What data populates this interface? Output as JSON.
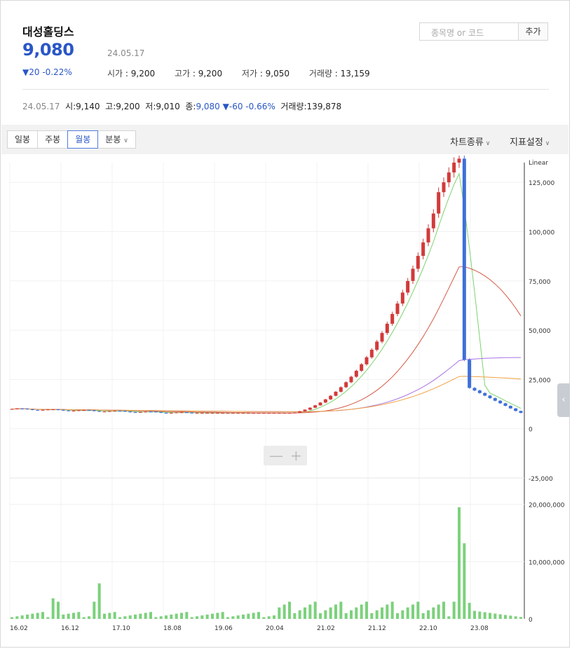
{
  "stock": {
    "name": "대성홀딩스",
    "price": "9,080",
    "date": "24.05.17",
    "change": "▼20 -0.22%",
    "open_label": "시가",
    "open": "9,200",
    "high_label": "고가",
    "high": "9,200",
    "low_label": "저가",
    "low": "9,050",
    "volume_label": "거래량",
    "volume": "13,159"
  },
  "search": {
    "placeholder": "종목명 or 코드",
    "add_label": "추가"
  },
  "daily": {
    "date": "24.05.17",
    "open_label": "시",
    "open": "9,140",
    "high_label": "고",
    "high": "9,200",
    "low_label": "저",
    "low": "9,010",
    "close_label": "종",
    "close": "9,080",
    "change": "▼-60 -0.66%",
    "volume_label": "거래량",
    "volume": "139,878"
  },
  "toolbar": {
    "tabs": [
      "일봉",
      "주봉",
      "월봉",
      "분봉"
    ],
    "active_tab": "월봉",
    "chart_type_label": "차트종류",
    "indicator_label": "지표설정"
  },
  "colors": {
    "up": "#d23a3a",
    "down": "#3f6fd8",
    "volume": "#7cd17c",
    "ma5": "#7bd36f",
    "ma20": "#d35a46",
    "ma60": "#a873e6",
    "ma120": "#f0a142"
  },
  "chart_data": {
    "type": "candlestick",
    "scale_label": "Linear",
    "price_ticks": [
      "125,000",
      "100,000",
      "75,000",
      "50,000",
      "25,000",
      "0",
      "-25,000"
    ],
    "price_ylim": [
      -25000,
      135000
    ],
    "volume_ticks": [
      "20,000,000",
      "10,000,000",
      "0"
    ],
    "volume_ylim": [
      0,
      24000000
    ],
    "x_ticks": [
      "16.02",
      "16.12",
      "17.10",
      "18.08",
      "19.06",
      "20.04",
      "21.02",
      "21.12",
      "22.10",
      "23.08"
    ]
  }
}
